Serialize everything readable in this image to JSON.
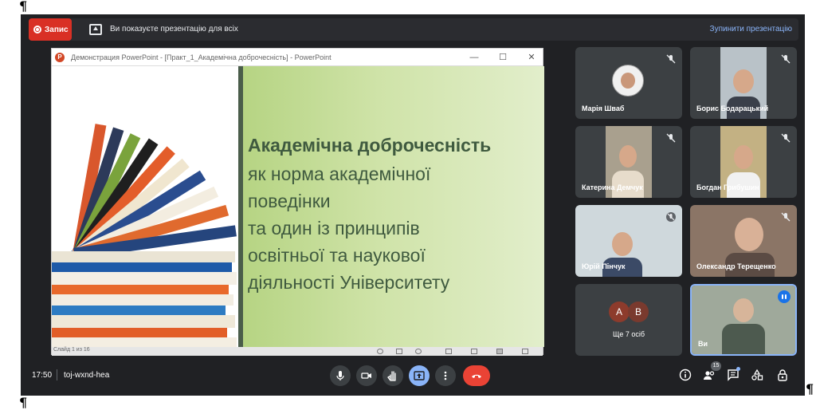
{
  "banner": {
    "record_label": "Запис",
    "present_notice": "Ви показуєте презентацію для всіх",
    "stop_label": "Зупинити презентацію"
  },
  "ppt": {
    "window_title": "Демонстрация PowerPoint - [Практ_1_Академічна доброчесність] - PowerPoint",
    "logo_letter": "P",
    "slide_counter": "Слайд 1 из 16",
    "slide": {
      "heading": "Академічна доброчесність",
      "lines": [
        "як норма академічної",
        "поведінки",
        "та один із принципів",
        "освітньої та наукової",
        "діяльності Університету"
      ]
    }
  },
  "participants": [
    {
      "name": "Марія Шваб"
    },
    {
      "name": "Борис Бодарацький"
    },
    {
      "name": "Катерина Демчук"
    },
    {
      "name": "Богдан Грибушин"
    },
    {
      "name": "Юрій Пінчук"
    },
    {
      "name": "Олександр Терещенко"
    }
  ],
  "more": {
    "avatars": [
      "А",
      "В"
    ],
    "label": "Ще 7 осіб"
  },
  "me": {
    "name": "Ви"
  },
  "bottom": {
    "time": "17:50",
    "meeting_code": "toj-wxnd-hea",
    "people_count": "15"
  },
  "pilcrow": "¶",
  "colors": {
    "background": "#202124",
    "tile": "#3c4043",
    "record_red": "#d93025",
    "hangup_red": "#ea4335",
    "accent_blue": "#8ab4f8",
    "slide_green": "#c5dc9c",
    "slide_text": "#3f5a3f"
  },
  "icons": [
    "record-icon",
    "present-icon",
    "mic-off-icon",
    "mic-icon",
    "camera-icon",
    "raise-hand-icon",
    "present-screen-icon",
    "more-options-icon",
    "hang-up-icon",
    "info-icon",
    "people-icon",
    "chat-icon",
    "activities-icon",
    "host-controls-icon"
  ]
}
